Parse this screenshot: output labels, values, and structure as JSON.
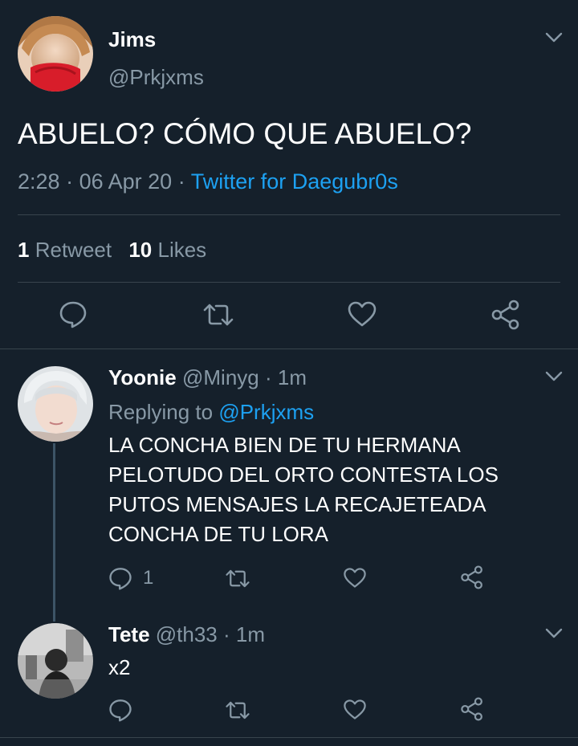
{
  "main_tweet": {
    "display_name": "Jims",
    "handle": "@Prkjxms",
    "text": "ABUELO? CÓMO QUE ABUELO?",
    "time": "2:28",
    "date": "06 Apr 20",
    "source": "Twitter for Daegubr0s",
    "sep1": "·",
    "sep2": "·",
    "retweet_count": "1",
    "retweet_label": "Retweet",
    "like_count": "10",
    "like_label": "Likes"
  },
  "replies": [
    {
      "display_name": "Yoonie",
      "handle": "@Minyg",
      "sep": "·",
      "time": "1m",
      "replying_label": "Replying to",
      "replying_handle": "@Prkjxms",
      "text_lines": [
        "LA CONCHA BIEN DE TU HERMANA",
        "PELOTUDO DEL ORTO CONTESTA LOS",
        "PUTOS MENSAJES LA RECAJETEADA",
        "CONCHA DE TU LORA"
      ],
      "reply_count": "1"
    },
    {
      "display_name": "Tete",
      "handle": "@th33",
      "sep": "·",
      "time": "1m",
      "text": "x2"
    }
  ],
  "colors": {
    "background": "#15202b",
    "text": "#ffffff",
    "muted": "#8899a6",
    "link": "#1da1f2",
    "divider": "#38444d"
  },
  "icons": [
    "chevron-down-icon",
    "reply-icon",
    "retweet-icon",
    "like-icon",
    "share-icon"
  ]
}
